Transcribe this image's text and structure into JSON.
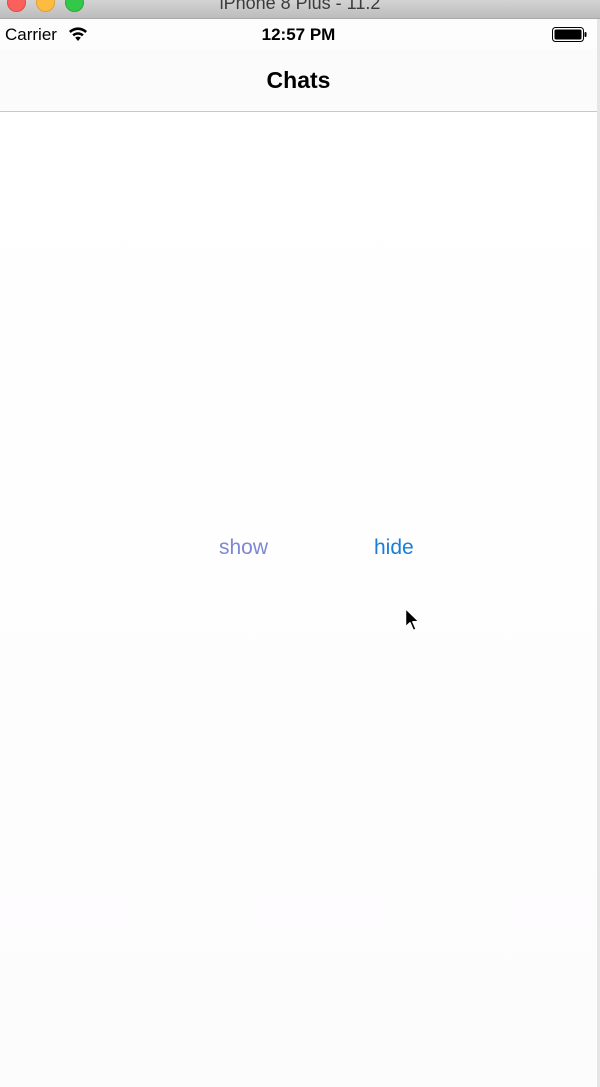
{
  "window": {
    "title": "iPhone 8 Plus - 11.2"
  },
  "status_bar": {
    "carrier": "Carrier",
    "time": "12:57 PM",
    "wifi_icon": "wifi-icon",
    "battery_icon": "battery-icon"
  },
  "nav": {
    "title": "Chats"
  },
  "buttons": {
    "show_label": "show",
    "hide_label": "hide"
  },
  "colors": {
    "show_button": "#7c88d4",
    "hide_button": "#1a7ed8",
    "background": "#fefdfe"
  },
  "cursor": {
    "icon": "mouse-pointer-icon"
  }
}
